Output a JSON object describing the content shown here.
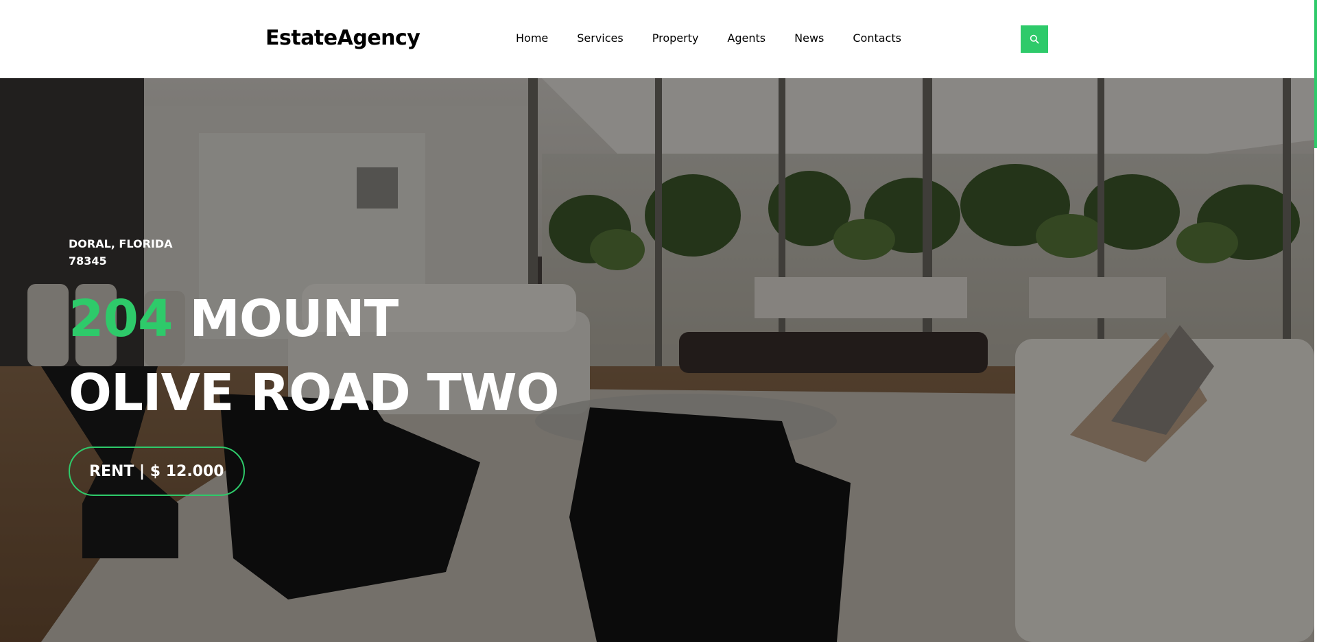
{
  "brand": {
    "name": "EstateAgency"
  },
  "nav": {
    "items": [
      {
        "label": "Home"
      },
      {
        "label": "Services"
      },
      {
        "label": "Property"
      },
      {
        "label": "Agents"
      },
      {
        "label": "News"
      },
      {
        "label": "Contacts"
      }
    ],
    "search_icon": "search-icon"
  },
  "hero": {
    "location_line1": "DORAL, FLORIDA",
    "location_line2": "78345",
    "title_number": "204",
    "title_rest_line1": "MOUNT",
    "title_line2": "OLIVE ROAD TWO",
    "rent_label": "RENT | $ 12.000"
  },
  "colors": {
    "accent": "#2eca6a",
    "text_dark": "#000000",
    "hero_text": "#ffffff"
  }
}
